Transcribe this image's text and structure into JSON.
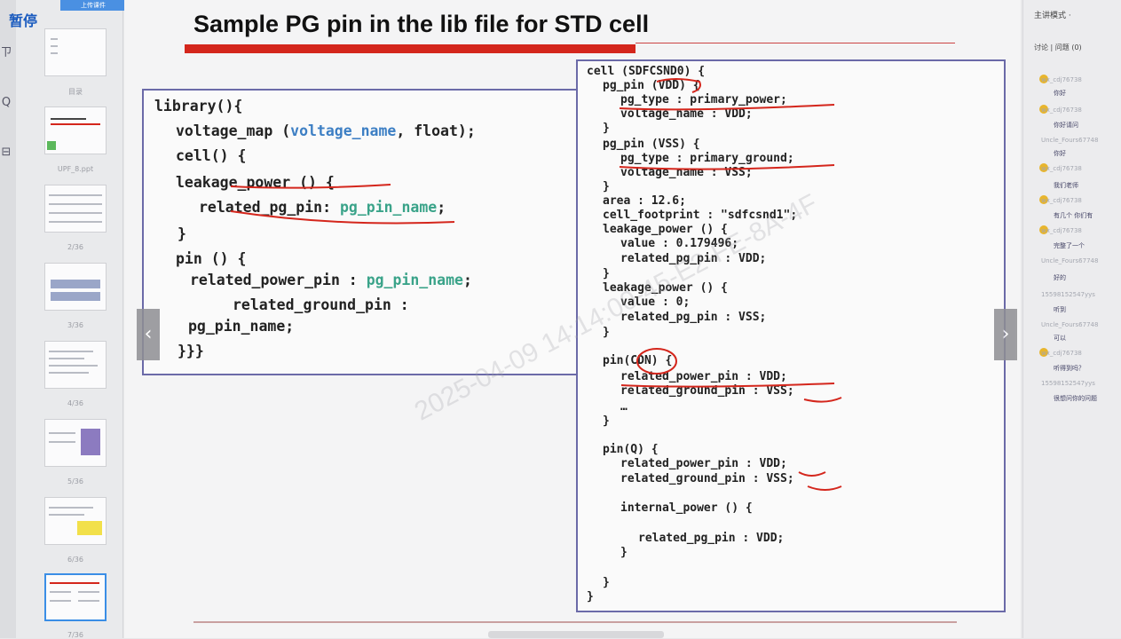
{
  "app": {
    "pause_label": "暂停",
    "upload_label": "上传课件"
  },
  "thumbnails": [
    {
      "label": "目录"
    },
    {
      "label": "UPF_8.ppt"
    },
    {
      "label": "2/36"
    },
    {
      "label": "3/36"
    },
    {
      "label": "4/36"
    },
    {
      "label": "5/36"
    },
    {
      "label": "6/36"
    },
    {
      "label": "7/36"
    }
  ],
  "slide": {
    "title": "Sample PG pin in the lib file for STD cell",
    "library_code": {
      "l1": "library(){",
      "l2_a": "voltage_map (",
      "l2_b": "voltage_name",
      "l2_c": ", float);",
      "l3": "cell() {",
      "l4": "leakage_power () {",
      "l5_a": "related_pg_pin: ",
      "l5_b": "pg_pin_name",
      "l5_c": ";",
      "l6": "}",
      "l7": "pin () {",
      "l8_a": "related_power_pin : ",
      "l8_b": "pg_pin_name",
      "l8_c": ";",
      "l9": "related_ground_pin :",
      "l10": "pg_pin_name;",
      "l11": "}}}"
    },
    "cell_code": {
      "c1": "cell (SDFCSND0) {",
      "c2": "pg_pin (VDD) {",
      "c3": "pg_type : primary_power;",
      "c4": "voltage_name : VDD;",
      "c5": "}",
      "c6": "pg_pin (VSS) {",
      "c7": "pg_type : primary_ground;",
      "c8": "voltage_name : VSS;",
      "c9": "}",
      "c10": "area : 12.6;",
      "c11": "cell_footprint : \"sdfcsnd1\";",
      "c12": "leakage_power () {",
      "c13": "value : 0.179496;",
      "c14": "related_pg_pin : VDD;",
      "c15": "}",
      "c16": "leakage_power () {",
      "c17": "value : 0;",
      "c18": "related_pg_pin : VSS;",
      "c19": "}",
      "c20": "pin(CDN) {",
      "c21": "related_power_pin : VDD;",
      "c22": "related_ground_pin : VSS;",
      "c23": "…",
      "c24": "}",
      "c25": "pin(Q) {",
      "c26": "related_power_pin : VDD;",
      "c27": "related_ground_pin : VSS;",
      "c28": "internal_power () {",
      "c29": "related_pg_pin : VDD;",
      "c30": "}",
      "c31": "}",
      "c32": "}"
    },
    "watermark": "2025-04-09 14:14:00-45-E2-FE-8A-4F"
  },
  "nav": {
    "prev": "‹",
    "next": "›"
  },
  "chat": {
    "mode_label": "主讲模式 ·",
    "tab_label": "讨论 | 问题 (0)",
    "messages": [
      {
        "name": "wx_cdj76738",
        "text": "你好"
      },
      {
        "name": "wx_cdj76738",
        "text": "你好请问"
      },
      {
        "name": "Uncle_Fours67748",
        "text": "你好"
      },
      {
        "name": "wx_cdj76738",
        "text": "我们老师"
      },
      {
        "name": "wx_cdj76738",
        "text": "有几个 你们有"
      },
      {
        "name": "wx_cdj76738",
        "text": "完整了一个"
      },
      {
        "name": "Uncle_Fours67748",
        "text": "好的"
      },
      {
        "name": "15598152547yys",
        "text": "听到"
      },
      {
        "name": "Uncle_Fours67748",
        "text": "可以"
      },
      {
        "name": "wx_cdj76738",
        "text": "听得到吗？"
      },
      {
        "name": "15598152547yys",
        "text": "很想问你的问题"
      }
    ]
  }
}
